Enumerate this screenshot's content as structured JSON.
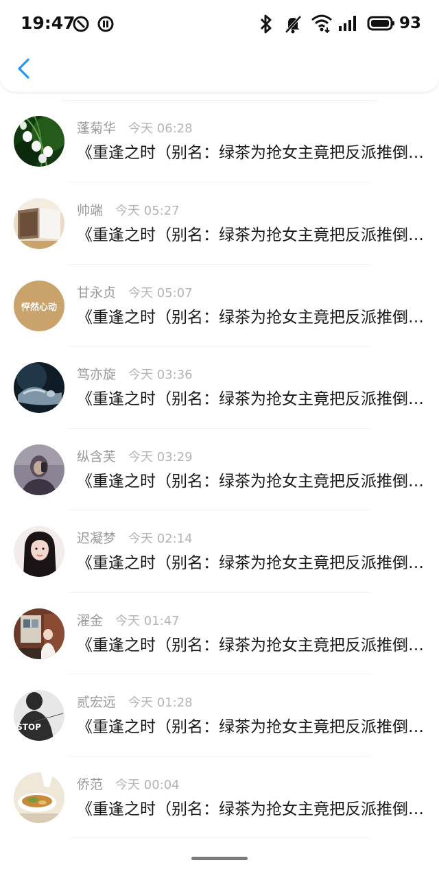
{
  "status_bar": {
    "time": "19:47",
    "battery": "93",
    "icons": [
      "alarm-icon",
      "pause-icon",
      "bluetooth-icon",
      "notification-muted-icon",
      "wifi-icon",
      "signal-icon",
      "battery-icon"
    ]
  },
  "header": {
    "back_icon": "chevron-left-icon",
    "accent_color": "#2196F3"
  },
  "comments": [
    {
      "name": "蓬菊华",
      "time": "今天 06:28",
      "text": "《重逢之时（别名：绿茶为抢女主竟把反派推倒）》",
      "avatar": "lily-flower"
    },
    {
      "name": "帅端",
      "time": "今天 05:27",
      "text": "《重逢之时（别名：绿茶为抢女主竟把反派推倒）》",
      "avatar": "open-book"
    },
    {
      "name": "甘永贞",
      "time": "今天 05:07",
      "text": "《重逢之时（别名：绿茶为抢女主竟把反派推倒）》",
      "avatar": "text-avatar",
      "avatar_text": "怦然心动"
    },
    {
      "name": "笃亦旋",
      "time": "今天 03:36",
      "text": "《重逢之时（别名：绿茶为抢女主竟把反派推倒）》",
      "avatar": "dark-figure"
    },
    {
      "name": "纵含芙",
      "time": "今天 03:29",
      "text": "《重逢之时（别名：绿茶为抢女主竟把反派推倒）》",
      "avatar": "selfie-person"
    },
    {
      "name": "迟凝梦",
      "time": "今天 02:14",
      "text": "《重逢之时（别名：绿茶为抢女主竟把反派推倒）》",
      "avatar": "girl-portrait"
    },
    {
      "name": "濯金",
      "time": "今天 01:47",
      "text": "《重逢之时（别名：绿茶为抢女主竟把反派推倒）》",
      "avatar": "room-person"
    },
    {
      "name": "贰宏远",
      "time": "今天 01:28",
      "text": "《重逢之时（别名：绿茶为抢女主竟把反派推倒）》",
      "avatar": "stop-shirt",
      "avatar_text": "STOP"
    },
    {
      "name": "侨范",
      "time": "今天 00:04",
      "text": "《重逢之时（别名：绿茶为抢女主竟把反派推倒）》",
      "avatar": "food-bowl"
    }
  ]
}
